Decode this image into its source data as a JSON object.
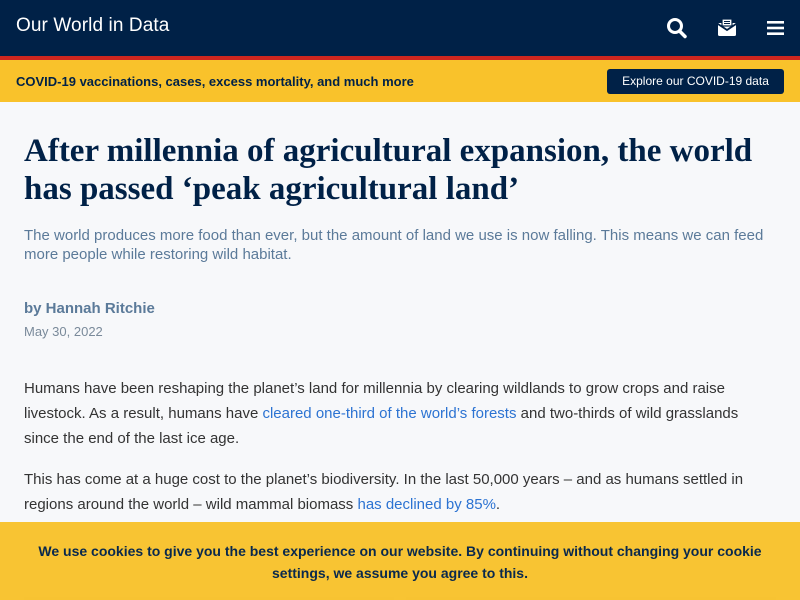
{
  "header": {
    "brand": "Our World in Data",
    "icons": [
      "search-icon",
      "mail-icon",
      "menu-icon"
    ],
    "colors": {
      "navy": "#002147",
      "accent_red": "#ce261e",
      "yellow": "#f9c22b",
      "link_blue": "#2c73d2"
    }
  },
  "covid_banner": {
    "text": "COVID-19 vaccinations, cases, excess mortality, and much more",
    "button_label": "Explore our COVID-19 data"
  },
  "article": {
    "title_line1": "After millennia of agricultural expansion, the world",
    "title_line2": "has passed ‘peak agricultural land’",
    "subtitle": "The world produces more food than ever, but the amount of land we use is now falling. This means we can feed more people while restoring wild habitat.",
    "byline": "by Hannah Ritchie",
    "date": "May 30, 2022",
    "p1_before": "Humans have been reshaping the planet’s land for millennia by clearing wildlands to grow crops and raise livestock. As a result, humans have ",
    "p1_link": "cleared one-third of the world’s forests",
    "p1_after": " and two-thirds of wild grasslands since the end of the last ice age.",
    "p2_before": "This has come at a huge cost to the planet’s biodiversity. In the last 50,000 years – and as humans settled in regions around the world – wild mammal biomass ",
    "p2_link": "has declined by 85%",
    "p2_after": "."
  },
  "cookie_notice": {
    "text": "We use cookies to give you the best experience on our website. By continuing without changing your cookie settings, we assume you agree to this."
  }
}
